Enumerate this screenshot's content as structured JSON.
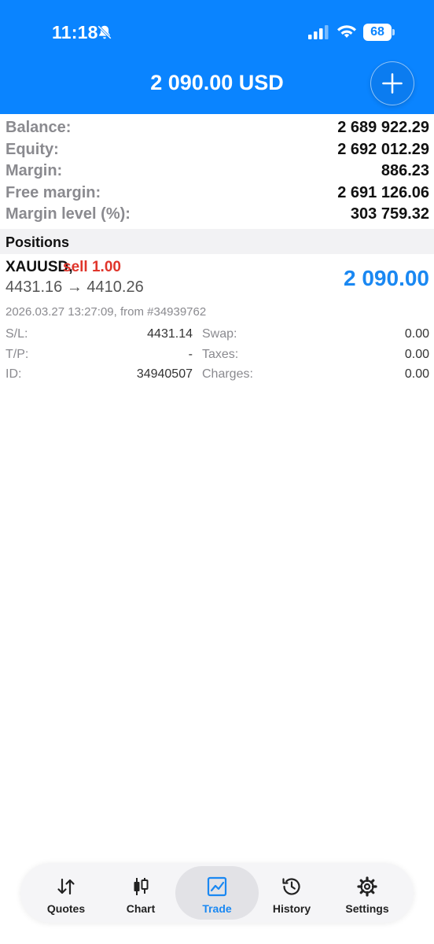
{
  "status_bar": {
    "time": "11:18",
    "battery": "68"
  },
  "header": {
    "title": "2 090.00 USD"
  },
  "summary": [
    {
      "label": "Balance:",
      "value": "2 689 922.29"
    },
    {
      "label": "Equity:",
      "value": "2 692 012.29"
    },
    {
      "label": "Margin:",
      "value": "886.23"
    },
    {
      "label": "Free margin:",
      "value": "2 691 126.06"
    },
    {
      "label": "Margin level (%):",
      "value": "303 759.32"
    }
  ],
  "positions": {
    "title": "Positions",
    "items": [
      {
        "symbol": "XAUUSD,",
        "side": "sell 1.00",
        "prices": "4431.16 → 4410.26",
        "profit": "2 090.00",
        "time": "2026.03.27 13:27:09, from #34939762",
        "details": {
          "sl_label": "S/L:",
          "sl_value": "4431.14",
          "tp_label": "T/P:",
          "tp_value": "-",
          "id_label": "ID:",
          "id_value": "34940507",
          "swap_label": "Swap:",
          "swap_value": "0.00",
          "taxes_label": "Taxes:",
          "taxes_value": "0.00",
          "charges_label": "Charges:",
          "charges_value": "0.00"
        }
      }
    ]
  },
  "nav": {
    "items": [
      {
        "label": "Quotes",
        "icon": "sort-arrows-icon"
      },
      {
        "label": "Chart",
        "icon": "candlestick-icon"
      },
      {
        "label": "Trade",
        "icon": "trend-chart-icon",
        "active": true
      },
      {
        "label": "History",
        "icon": "history-clock-icon"
      },
      {
        "label": "Settings",
        "icon": "gear-icon"
      }
    ]
  },
  "colors": {
    "header": "#0a84ff",
    "sell": "#e0352b",
    "profit": "#1a88f2"
  }
}
